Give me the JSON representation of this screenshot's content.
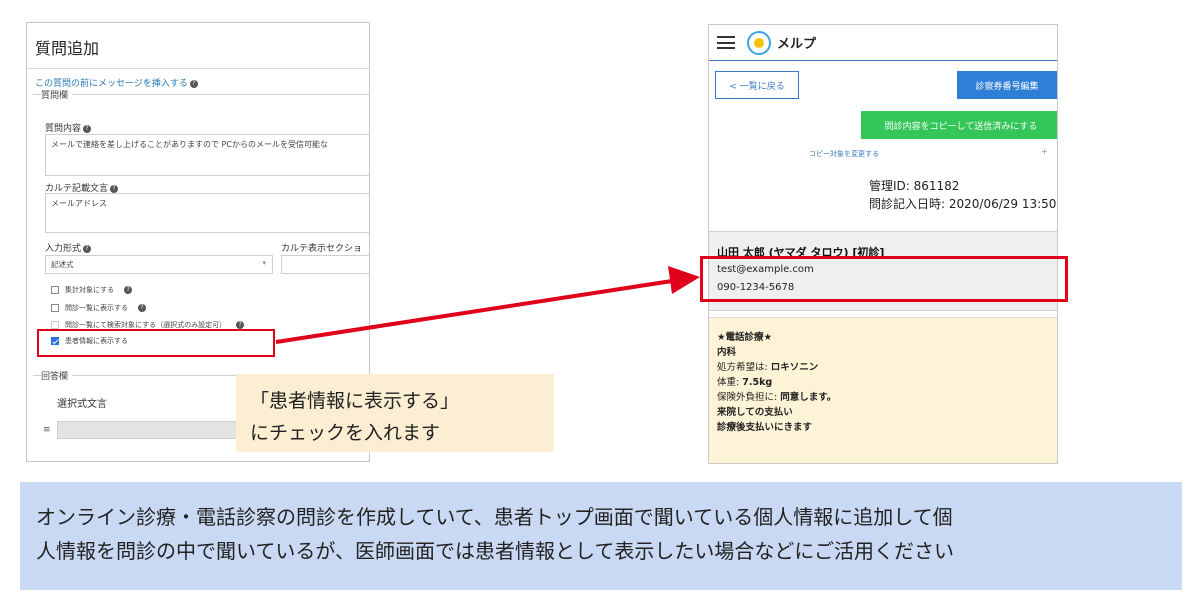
{
  "left_panel": {
    "title": "質問追加",
    "insert_message_link": "この質問の前にメッセージを挿入する",
    "question_legend": "質問欄",
    "question_content_label": "質問内容",
    "question_content_value": "メールで連絡を差し上げることがありますので PCからのメールを受信可能な",
    "karte_text_label": "カルテ記載文言",
    "karte_text_value": "メールアドレス",
    "input_type_label": "入力形式",
    "input_type_value": "記述式",
    "karte_section_label": "カルテ表示セクショ",
    "checkboxes": [
      {
        "label": "集計対象にする",
        "checked": false
      },
      {
        "label": "問診一覧に表示する",
        "checked": false
      },
      {
        "label": "問診一覧にて検索対象にする（選択式のみ設定可）",
        "checked": false
      },
      {
        "label": "患者情報に表示する",
        "checked": true
      }
    ],
    "answer_legend": "回答欄",
    "choice_text_label": "選択式文言",
    "list_icon": "list-icon"
  },
  "callout": {
    "line1": "「患者情報に表示する」",
    "line2": "にチェックを入れます"
  },
  "right_panel": {
    "app_name": "メルプ",
    "back_button": "< 一覧に戻る",
    "edit_button": "診察券番号編集",
    "copy_button": "問診内容をコピーして送信済みにする",
    "change_copy_target": "コピー対象を変更する",
    "plus": "+",
    "management_id": "管理ID: 861182",
    "entry_datetime": "問診記入日時: 2020/06/29 13:50",
    "patient_name": "山田 太郎 (ヤマダ タロウ) [初診]",
    "email": "test@example.com",
    "phone": "090-1234-5678",
    "note_lines": [
      {
        "text": "★電話診療★",
        "bold": true
      },
      {
        "text": "内科",
        "bold": true
      }
    ],
    "prescription_label": "処方希望は: ",
    "prescription_value": "ロキソニン",
    "weight_label": "体重: ",
    "weight_value": "7.5kg",
    "insurance_label": "保険外負担に: ",
    "insurance_value": "同意します。",
    "payment_line1": "来院しての支払い",
    "payment_line2": "診療後支払いにきます"
  },
  "banner": {
    "line1": "オンライン診療・電話診察の問診を作成していて、患者トップ画面で聞いている個人情報に追加して個",
    "line2": "人情報を問診の中で聞いているが、医師画面では患者情報として表示したい場合などにご活用ください"
  },
  "colors": {
    "highlight_red": "#e0001b",
    "primary_blue": "#2f7fd6",
    "copy_green": "#34c659",
    "callout_bg": "#fbeed2",
    "banner_bg": "#c9d9f3"
  }
}
